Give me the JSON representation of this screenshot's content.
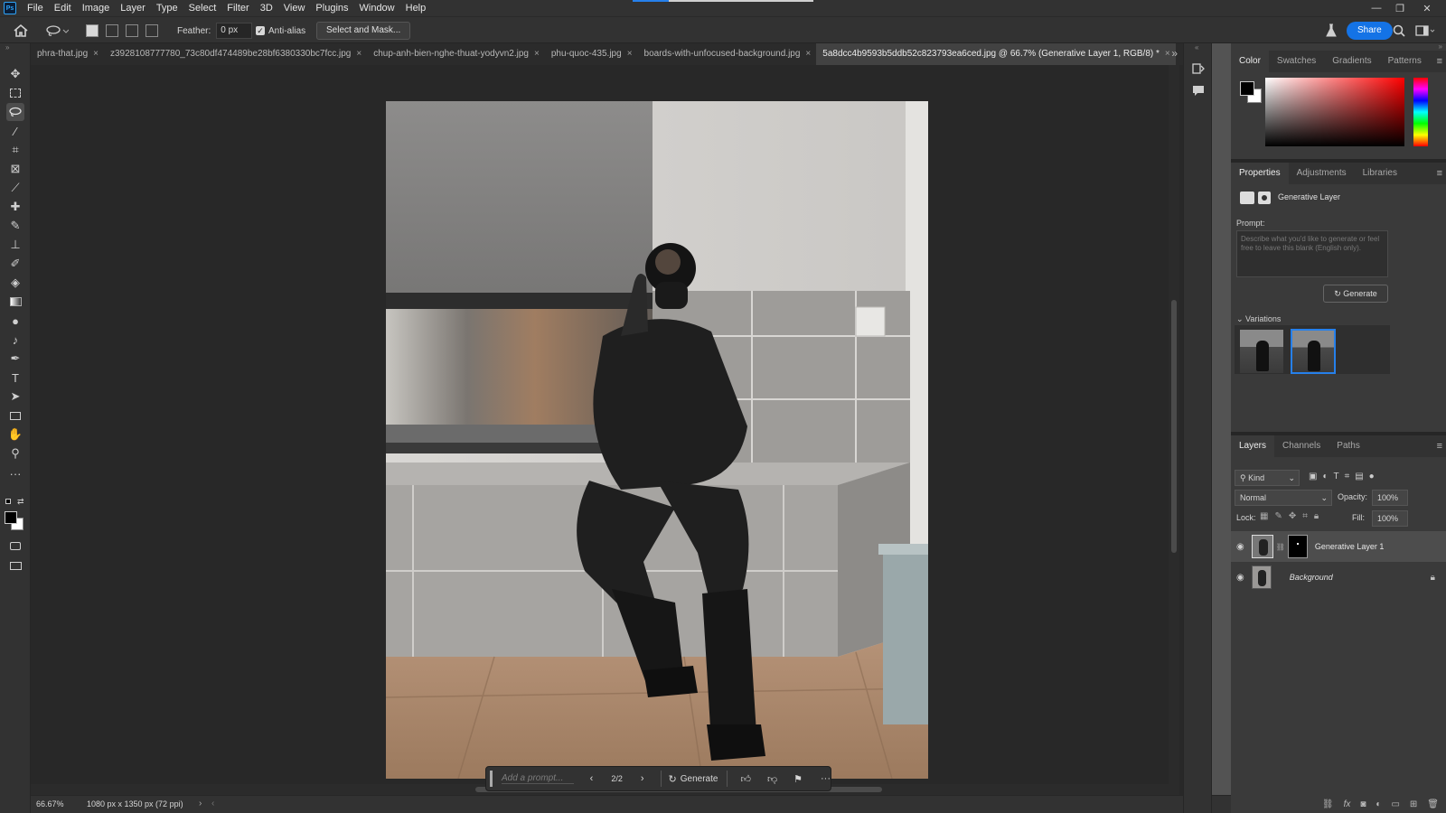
{
  "app": {
    "logo": "Ps"
  },
  "menu": [
    "File",
    "Edit",
    "Image",
    "Layer",
    "Type",
    "Select",
    "Filter",
    "3D",
    "View",
    "Plugins",
    "Window",
    "Help"
  ],
  "window_controls": {
    "minimize": "—",
    "restore": "❐",
    "close": "✕"
  },
  "options": {
    "feather_label": "Feather:",
    "feather_value": "0 px",
    "antialias_label": "Anti-alias",
    "antialias_checked": true,
    "select_mask_label": "Select and Mask...",
    "share_label": "Share"
  },
  "tabs": [
    {
      "label": "phra-that.jpg",
      "active": false
    },
    {
      "label": "z3928108777780_73c80df474489be28bf6380330bc7fcc.jpg",
      "active": false
    },
    {
      "label": "chup-anh-bien-nghe-thuat-yodyvn2.jpg",
      "active": false
    },
    {
      "label": "phu-quoc-435.jpg",
      "active": false
    },
    {
      "label": "boards-with-unfocused-background.jpg",
      "active": false
    },
    {
      "label": "5a8dcc4b9593b5ddb52c823793ea6ced.jpg @ 66.7% (Generative Layer 1, RGB/8) *",
      "active": true
    }
  ],
  "taskbar": {
    "prompt_placeholder": "Add a prompt...",
    "counter": "2/2",
    "generate_label": "Generate"
  },
  "status": {
    "zoom": "66.67%",
    "doc_info": "1080 px x 1350 px (72 ppi)"
  },
  "color_panel": {
    "tabs": [
      "Color",
      "Swatches",
      "Gradients",
      "Patterns"
    ],
    "active_tab": "Color",
    "foreground": "#000000",
    "background": "#ffffff",
    "hue": "#ff0000"
  },
  "properties": {
    "tabs": [
      "Properties",
      "Adjustments",
      "Libraries"
    ],
    "layer_type": "Generative Layer",
    "prompt_label": "Prompt:",
    "prompt_placeholder": "Describe what you'd like to generate or feel free to leave this blank (English only).",
    "generate_label": "Generate",
    "variations_label": "Variations",
    "variations_count": 2,
    "selected_variation": 2
  },
  "layers_panel": {
    "tabs": [
      "Layers",
      "Channels",
      "Paths"
    ],
    "filter_kind": "Kind",
    "blend_mode": "Normal",
    "opacity_label": "Opacity:",
    "opacity": "100%",
    "lock_label": "Lock:",
    "fill_label": "Fill:",
    "fill": "100%",
    "layers": [
      {
        "name": "Generative Layer 1",
        "visible": true,
        "selected": true,
        "locked": false
      },
      {
        "name": "Background",
        "visible": true,
        "selected": false,
        "locked": true
      }
    ]
  },
  "colors": {
    "accent": "#1473e6",
    "selection": "#2680eb"
  }
}
